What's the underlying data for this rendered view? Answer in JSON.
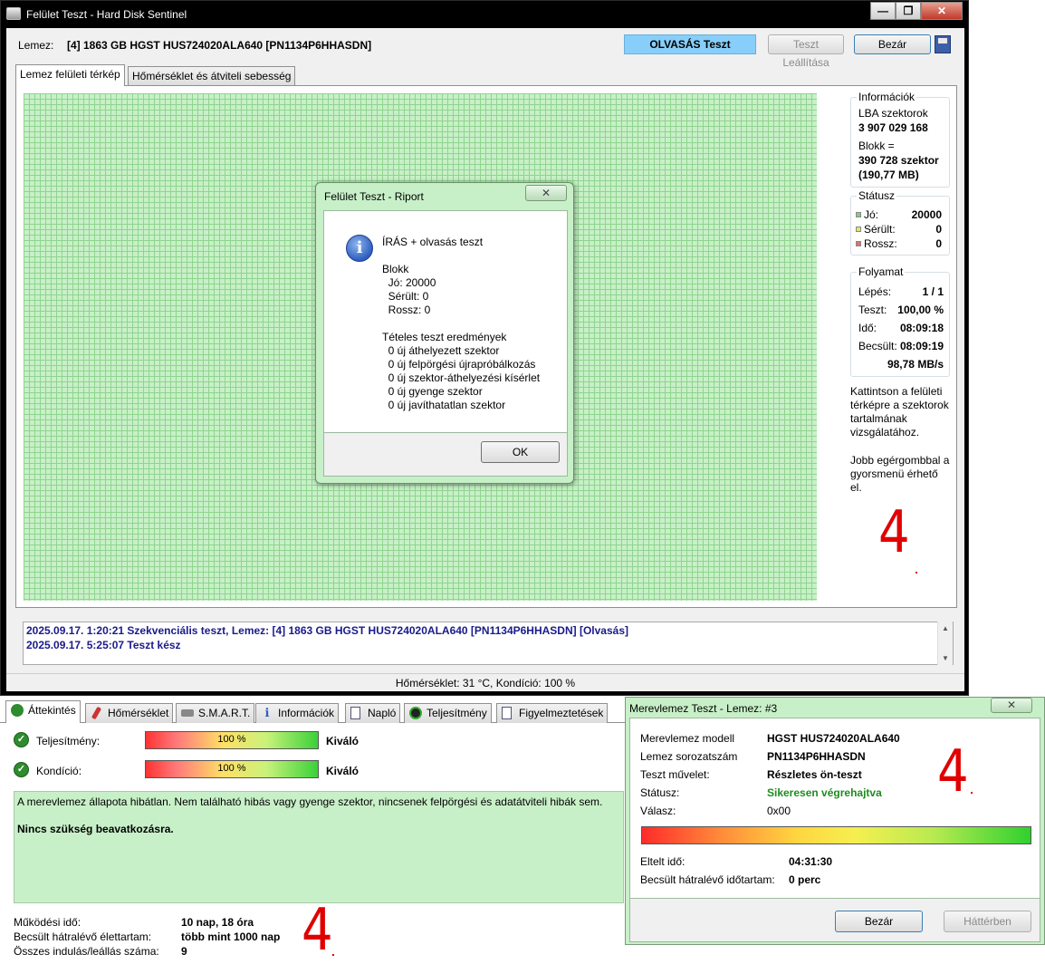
{
  "main_window": {
    "title": "Felület Teszt - Hard Disk Sentinel",
    "caption_buttons": [
      "—",
      "❐",
      "✕"
    ],
    "disk_label": "Lemez:",
    "disk_name": "[4] 1863 GB  HGST HUS724020ALA640 [PN1134P6HHASDN]",
    "read_test_label": "OLVASÁS Teszt",
    "stop_test_label": "Teszt Leállítása",
    "close_label": "Bezár",
    "tabs": [
      "Lemez felületi térkép",
      "Hőmérséklet és átviteli sebesség"
    ]
  },
  "info_panel": {
    "info_title": "Információk",
    "lba_label": "LBA szektorok",
    "lba_value": "3 907 029 168",
    "block_label": "Blokk =",
    "block_sectors": "390 728 szektor",
    "block_size": "(190,77 MB)",
    "status_title": "Státusz",
    "status": [
      {
        "label": "Jó:",
        "value": "20000",
        "color": "#7ed07e"
      },
      {
        "label": "Sérült:",
        "value": "0",
        "color": "#e8e36a"
      },
      {
        "label": "Rossz:",
        "value": "0",
        "color": "#e07070"
      }
    ],
    "progress_title": "Folyamat",
    "progress": [
      {
        "label": "Lépés:",
        "value": "1 / 1"
      },
      {
        "label": "Teszt:",
        "value": "100,00 %"
      },
      {
        "label": "Idő:",
        "value": "08:09:18"
      },
      {
        "label": "Becsült:",
        "value": "08:09:19"
      }
    ],
    "speed": "98,78 MB/s",
    "hint1": [
      "Kattintson a felületi",
      "térképre a szektorok",
      "tartalmának",
      "vizsgálatához."
    ],
    "hint2": [
      "Jobb egérgombbal a",
      "gyorsmenü érhető",
      "el."
    ]
  },
  "log": [
    "2025.09.17.  1:20:21   Szekvenciális teszt, Lemez: [4] 1863 GB  HGST HUS724020ALA640 [PN1134P6HHASDN] [Olvasás]",
    "2025.09.17.  5:25:07   Teszt kész"
  ],
  "status_bar": "Hőmérséklet: 31  °C,  Kondíció: 100 %",
  "report_dialog": {
    "title": "Felület Teszt - Riport",
    "close_glyph": "✕",
    "lines": [
      "ÍRÁS + olvasás teszt",
      "",
      "Blokk",
      "  Jó: 20000",
      "  Sérült: 0",
      "  Rossz: 0",
      "",
      "Tételes teszt eredmények",
      "  0 új áthelyezett szektor",
      "  0 új felpörgési újrapróbálkozás",
      "  0 új szektor-áthelyezési kísérlet",
      "  0 új gyenge szektor",
      "  0 új javíthatatlan szektor"
    ],
    "ok_label": "OK"
  },
  "overview": {
    "tabs": [
      "Áttekintés",
      "Hőmérséklet",
      "S.M.A.R.T.",
      "Információk",
      "Napló",
      "Teljesítmény",
      "Figyelmeztetések"
    ],
    "performance_label": "Teljesítmény:",
    "performance_value": "100 %",
    "performance_rating": "Kiváló",
    "condition_label": "Kondíció:",
    "condition_value": "100 %",
    "condition_rating": "Kiváló",
    "summary": "A merevlemez állapota hibátlan. Nem található hibás vagy gyenge szektor, nincsenek felpörgési és adatátviteli hibák sem.",
    "action": "Nincs szükség beavatkozásra.",
    "stats": [
      {
        "label": "Működési idő:",
        "value": "10 nap, 18 óra"
      },
      {
        "label": "Becsült hátralévő élettartam:",
        "value": "több mint 1000 nap"
      },
      {
        "label": "Összes indulás/leállás száma:",
        "value": "9"
      }
    ]
  },
  "selftest_dialog": {
    "title": "Merevlemez Teszt - Lemez: #3",
    "close_glyph": "✕",
    "rows": [
      {
        "label": "Merevlemez modell",
        "value": "HGST HUS724020ALA640"
      },
      {
        "label": "Lemez sorozatszám",
        "value": "PN1134P6HHASDN"
      },
      {
        "label": "Teszt művelet:",
        "value": "Részletes ön-teszt"
      },
      {
        "label": "Státusz:",
        "value": "Sikeresen végrehajtva",
        "color": "#1e8c1e"
      },
      {
        "label": "Válasz:",
        "value": "0x00"
      }
    ],
    "elapsed_label": "Eltelt idő:",
    "elapsed_value": "04:31:30",
    "remaining_label": "Becsült hátralévő időtartam:",
    "remaining_value": "0 perc",
    "close_label": "Bezár",
    "background_label": "Háttérben"
  },
  "annotations": [
    "4",
    "4",
    "4"
  ]
}
